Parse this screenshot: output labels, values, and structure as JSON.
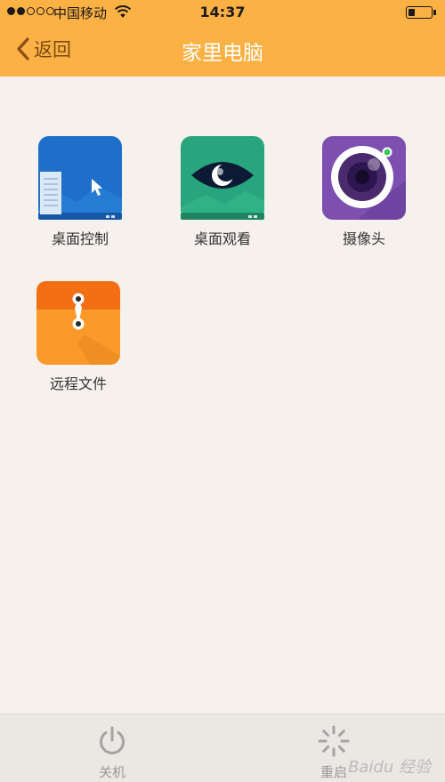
{
  "status_bar": {
    "carrier": "中国移动",
    "time": "14:37",
    "signal_bars_full": 2,
    "signal_bars_total": 5
  },
  "nav": {
    "back_label": "返回",
    "title": "家里电脑"
  },
  "apps": [
    {
      "label": "桌面控制",
      "icon": "desktop-control-icon",
      "color": "#1e6fc9"
    },
    {
      "label": "桌面观看",
      "icon": "eye-icon",
      "color": "#28a57c"
    },
    {
      "label": "摄像头",
      "icon": "camera-icon",
      "color": "#7d4fb0"
    },
    {
      "label": "远程文件",
      "icon": "folder-file-icon",
      "color": "#fb9a2a"
    }
  ],
  "toolbar": {
    "shutdown_label": "关机",
    "restart_label": "重启"
  },
  "colors": {
    "header": "#fcb145",
    "background": "#f6f1ec",
    "toolbar": "#ebe8e4"
  },
  "watermark": "Baidu 经验"
}
